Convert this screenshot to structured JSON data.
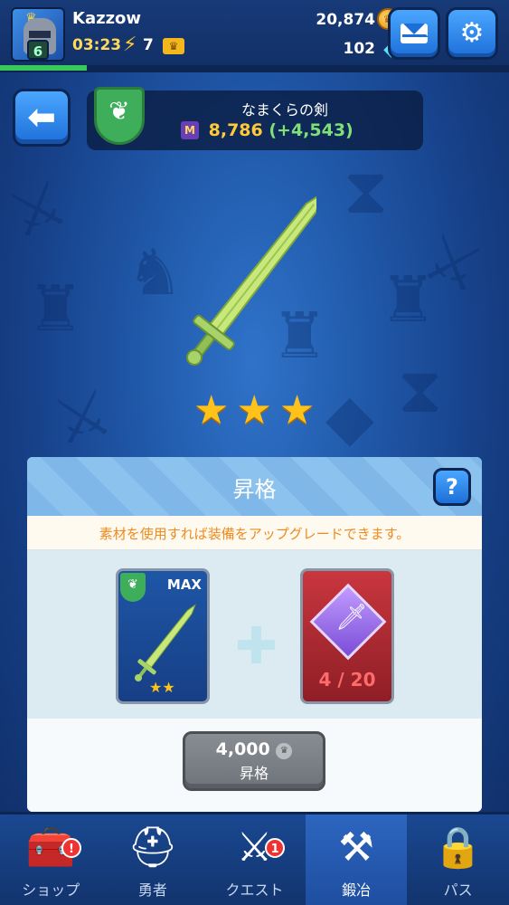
{
  "player": {
    "name": "Kazzow",
    "level": "6",
    "timer": "03:23",
    "energy": "7",
    "xp_progress": 0.17,
    "gold": "20,874",
    "gems": "102"
  },
  "item": {
    "name": "なまくらの剣",
    "power": "8,786",
    "power_bonus": "(+4,543)",
    "stars": 3
  },
  "upgrade_panel": {
    "title": "昇格",
    "help_label": "?",
    "description": "素材を使用すれば装備をアップグレードできます。",
    "material_card": {
      "tag": "MAX",
      "stars": 2
    },
    "shard_card": {
      "count": "4 / 20"
    },
    "cost": "4,000",
    "button_label": "昇格"
  },
  "nav": [
    {
      "label": "ショップ",
      "icon": "treasure-chest-icon",
      "badge": "!",
      "active": false
    },
    {
      "label": "勇者",
      "icon": "knight-helmet-icon",
      "badge": "",
      "active": false
    },
    {
      "label": "クエスト",
      "icon": "shield-sword-icon",
      "badge": "1",
      "active": false
    },
    {
      "label": "鍛冶",
      "icon": "anvil-icon",
      "badge": "",
      "active": true
    },
    {
      "label": "パス",
      "icon": "locked-emblem-icon",
      "badge": "",
      "active": false
    }
  ],
  "colors": {
    "accent_blue": "#1d6fd8",
    "gold": "#ffc93a",
    "bonus_green": "#7fe07a",
    "desc_orange": "#ee8a1f",
    "xp_green": "#39c85a"
  }
}
